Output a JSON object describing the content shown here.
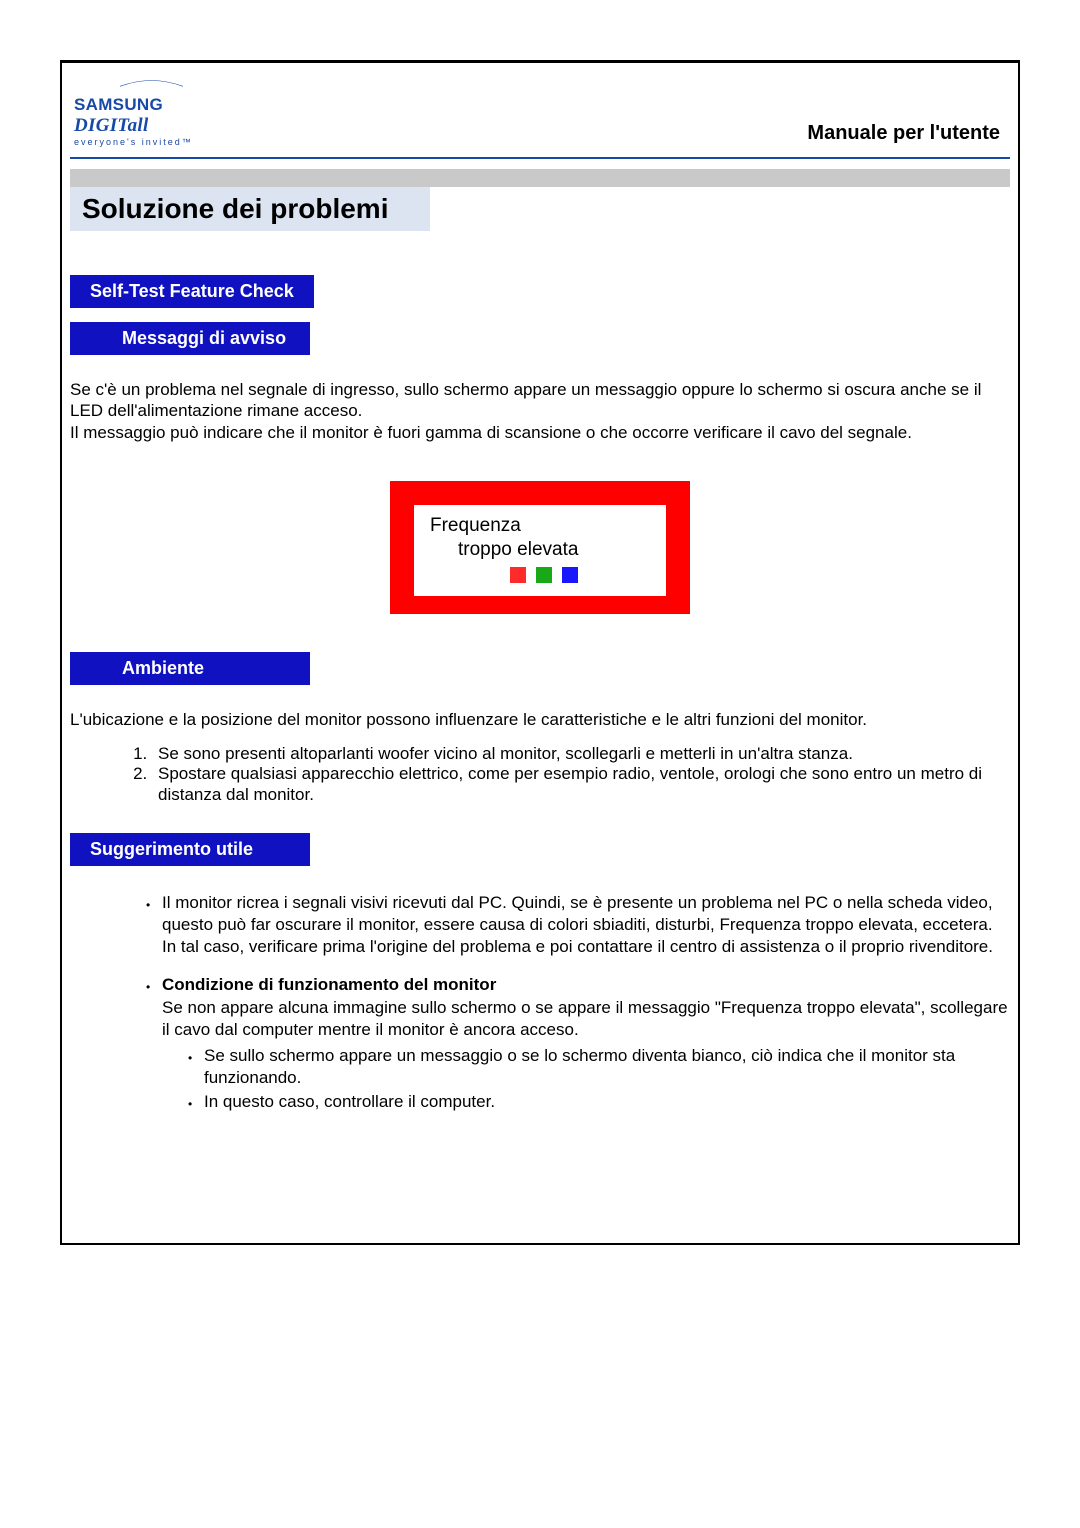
{
  "logo": {
    "brand_plain": "SAMSUNG ",
    "brand_italic": "DIGITall",
    "tagline": "everyone's invited™"
  },
  "header": {
    "manual_title": "Manuale per l'utente"
  },
  "page_title": "Soluzione dei problemi",
  "sections": {
    "self_test": {
      "heading": "Self-Test Feature Check"
    },
    "warning_messages": {
      "heading": "Messaggi di avviso",
      "para": "Se c'è un problema nel segnale di ingresso, sullo schermo appare un messaggio oppure lo schermo si oscura anche se il LED dell'alimentazione rimane acceso.\nIl messaggio può indicare che il monitor è fuori gamma di scansione o che occorre verificare il cavo del segnale.",
      "box_line1": "Frequenza",
      "box_line2": "troppo elevata"
    },
    "environment": {
      "heading": "Ambiente",
      "para": "L'ubicazione e la posizione del monitor possono influenzare le caratteristiche e le altri funzioni del monitor.",
      "items": [
        "Se sono presenti altoparlanti woofer vicino al monitor, scollegarli e metterli in un'altra stanza.",
        "Spostare qualsiasi apparecchio elettrico, come per esempio radio, ventole, orologi che sono entro un metro di distanza dal monitor."
      ]
    },
    "tip": {
      "heading": "Suggerimento utile",
      "bullets": [
        {
          "text": "Il monitor ricrea i segnali visivi ricevuti dal PC. Quindi, se è presente un problema nel PC o nella scheda video, questo può far oscurare il monitor, essere causa di colori sbiaditi, disturbi, Frequenza troppo elevata, eccetera. In tal caso, verificare prima l'origine del problema e poi contattare il centro di assistenza o il proprio rivenditore."
        },
        {
          "bold_lead": "Condizione di funzionamento del monitor",
          "text": "Se non appare alcuna immagine sullo schermo o se appare il messaggio \"Frequenza troppo elevata\", scollegare il cavo dal computer mentre il monitor è ancora acceso.",
          "sub": [
            "Se sullo schermo appare un messaggio o se lo schermo diventa bianco, ciò indica che il monitor sta funzionando.",
            "In questo caso, controllare il computer."
          ]
        }
      ]
    }
  }
}
